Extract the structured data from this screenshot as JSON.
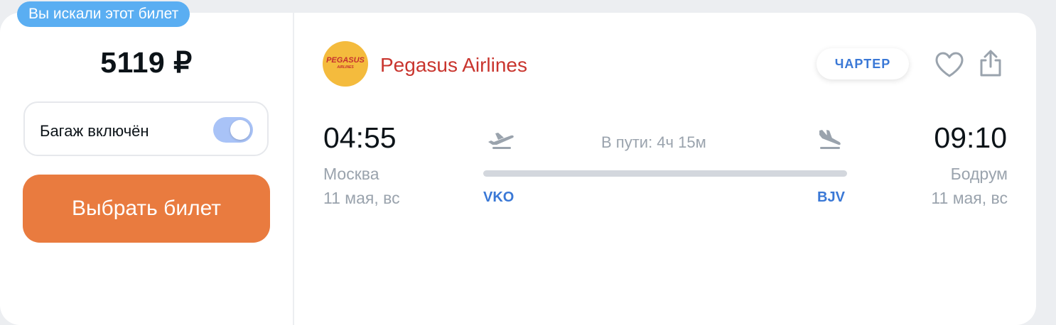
{
  "badge": "Вы искали этот билет",
  "price": "5119 ₽",
  "baggage": {
    "label": "Багаж включён",
    "enabled": true
  },
  "select_button": "Выбрать билет",
  "airline": {
    "logo_text": "PEGASUS",
    "logo_subtext": "AIRLINES",
    "name": "Pegasus Airlines"
  },
  "charter_tag": "ЧАРТЕР",
  "departure": {
    "time": "04:55",
    "city": "Москва",
    "date": "11 мая, вс",
    "code": "VKO"
  },
  "arrival": {
    "time": "09:10",
    "city": "Бодрум",
    "date": "11 мая, вс",
    "code": "BJV"
  },
  "duration": "В пути: 4ч 15м",
  "colors": {
    "badge": "#5aaef2",
    "button": "#e97b3f",
    "accent": "#3a78d6",
    "airline": "#c9352e",
    "toggle": "#a9c3f7"
  }
}
